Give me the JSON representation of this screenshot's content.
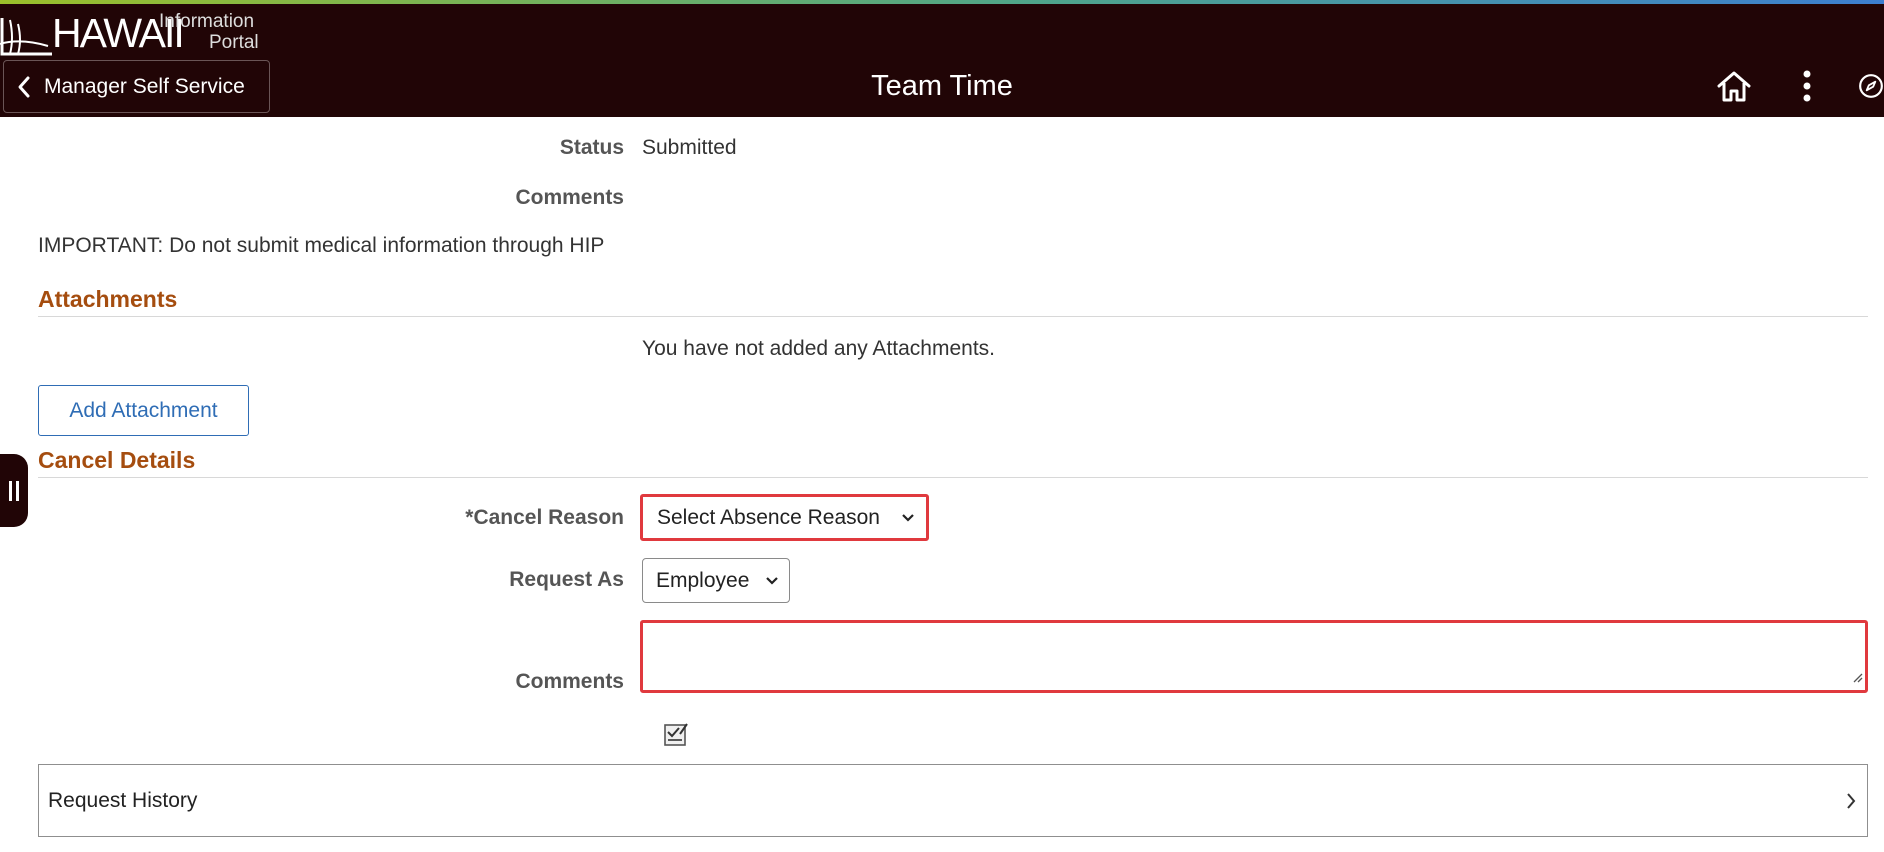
{
  "header": {
    "logo_main": "HAWAII",
    "logo_sub_line1": "Information",
    "logo_sub_line2": "Portal",
    "back_label": "Manager Self Service",
    "title": "Team Time",
    "icons": [
      "home-icon",
      "more-actions-icon",
      "navbar-compass-icon"
    ]
  },
  "details": {
    "status_label": "Status",
    "status_value": "Submitted",
    "comments_label": "Comments",
    "important_note": "IMPORTANT: Do not submit medical information through HIP"
  },
  "attachments": {
    "title": "Attachments",
    "empty_message": "You have not added any Attachments.",
    "add_button": "Add Attachment"
  },
  "cancel_details": {
    "title": "Cancel Details",
    "cancel_reason_label": "*Cancel Reason",
    "cancel_reason_value": "Select Absence Reason",
    "request_as_label": "Request As",
    "request_as_value": "Employee",
    "comments_label": "Comments",
    "comments_value": ""
  },
  "request_history": {
    "label": "Request History"
  },
  "colors": {
    "header_bg": "#210506",
    "section_title": "#a54d0f",
    "error_outline": "#e0393e",
    "link_blue": "#2f6db5"
  }
}
